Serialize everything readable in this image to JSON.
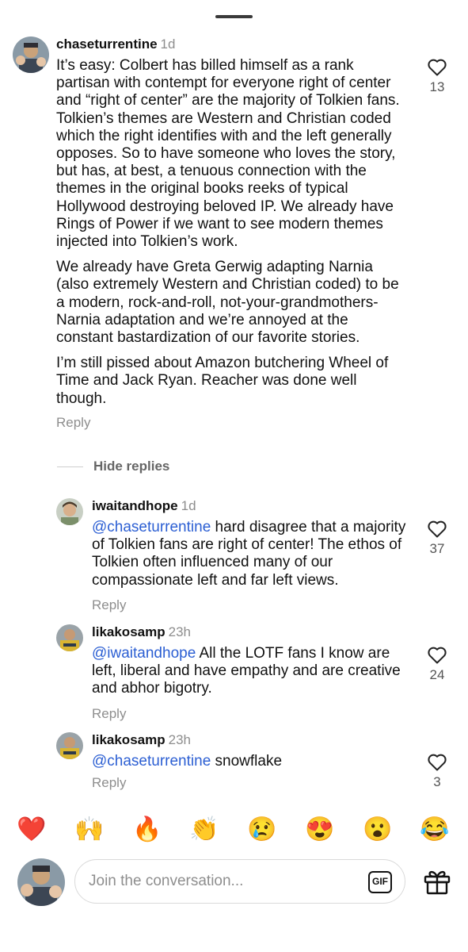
{
  "comments": [
    {
      "user": "chaseturrentine",
      "time": "1d",
      "paragraphs": [
        "It’s easy: Colbert has billed himself as a rank partisan with contempt for everyone right of center and “right of center” are the majority of Tolkien fans.  Tolkien’s themes are Western and Christian coded which the right identifies with and the left generally opposes. So to have someone who loves the story, but has, at best, a tenuous connection with the themes in the original books reeks of typical Hollywood destroying beloved IP. We already have Rings of Power if we want to see modern themes injected into Tolkien’s work.",
        "We already have Greta Gerwig adapting Narnia (also extremely Western and Christian coded) to be a modern, rock-and-roll, not-your-grandmothers-Narnia adaptation and we’re annoyed at the constant bastardization of our favorite stories.",
        "I’m still pissed about Amazon butchering Wheel of Time and Jack Ryan. Reacher was done well though."
      ],
      "reply_label": "Reply",
      "likes": "13"
    },
    {
      "user": "iwaitandhope",
      "time": "1d",
      "mention": "@chaseturrentine",
      "text": " hard disagree that a majority of Tolkien fans are right of center! The ethos of Tolkien often influenced many of our compassionate left and far left views.",
      "reply_label": "Reply",
      "likes": "37"
    },
    {
      "user": "likakosamp",
      "time": "23h",
      "mention": "@iwaitandhope",
      "text": " All the LOTF fans I know are left, liberal and have empathy and are creative and abhor bigotry.",
      "reply_label": "Reply",
      "likes": "24"
    },
    {
      "user": "likakosamp",
      "time": "23h",
      "mention": "@chaseturrentine",
      "text": " snowflake",
      "reply_label": "Reply",
      "likes": "3"
    }
  ],
  "hide_replies_label": "Hide replies",
  "quick_reactions": [
    "❤️",
    "🙌",
    "🔥",
    "👏",
    "😢",
    "😍",
    "😮",
    "😂"
  ],
  "composer": {
    "placeholder": "Join the conversation...",
    "gif_label": "GIF"
  },
  "icons": {
    "like": "heart-outline-icon",
    "gif": "gif-icon",
    "gift": "gift-icon",
    "handle": "drag-handle"
  },
  "colors": {
    "mention": "#2c5fd3",
    "muted": "#8e8e8e",
    "text": "#111111"
  }
}
